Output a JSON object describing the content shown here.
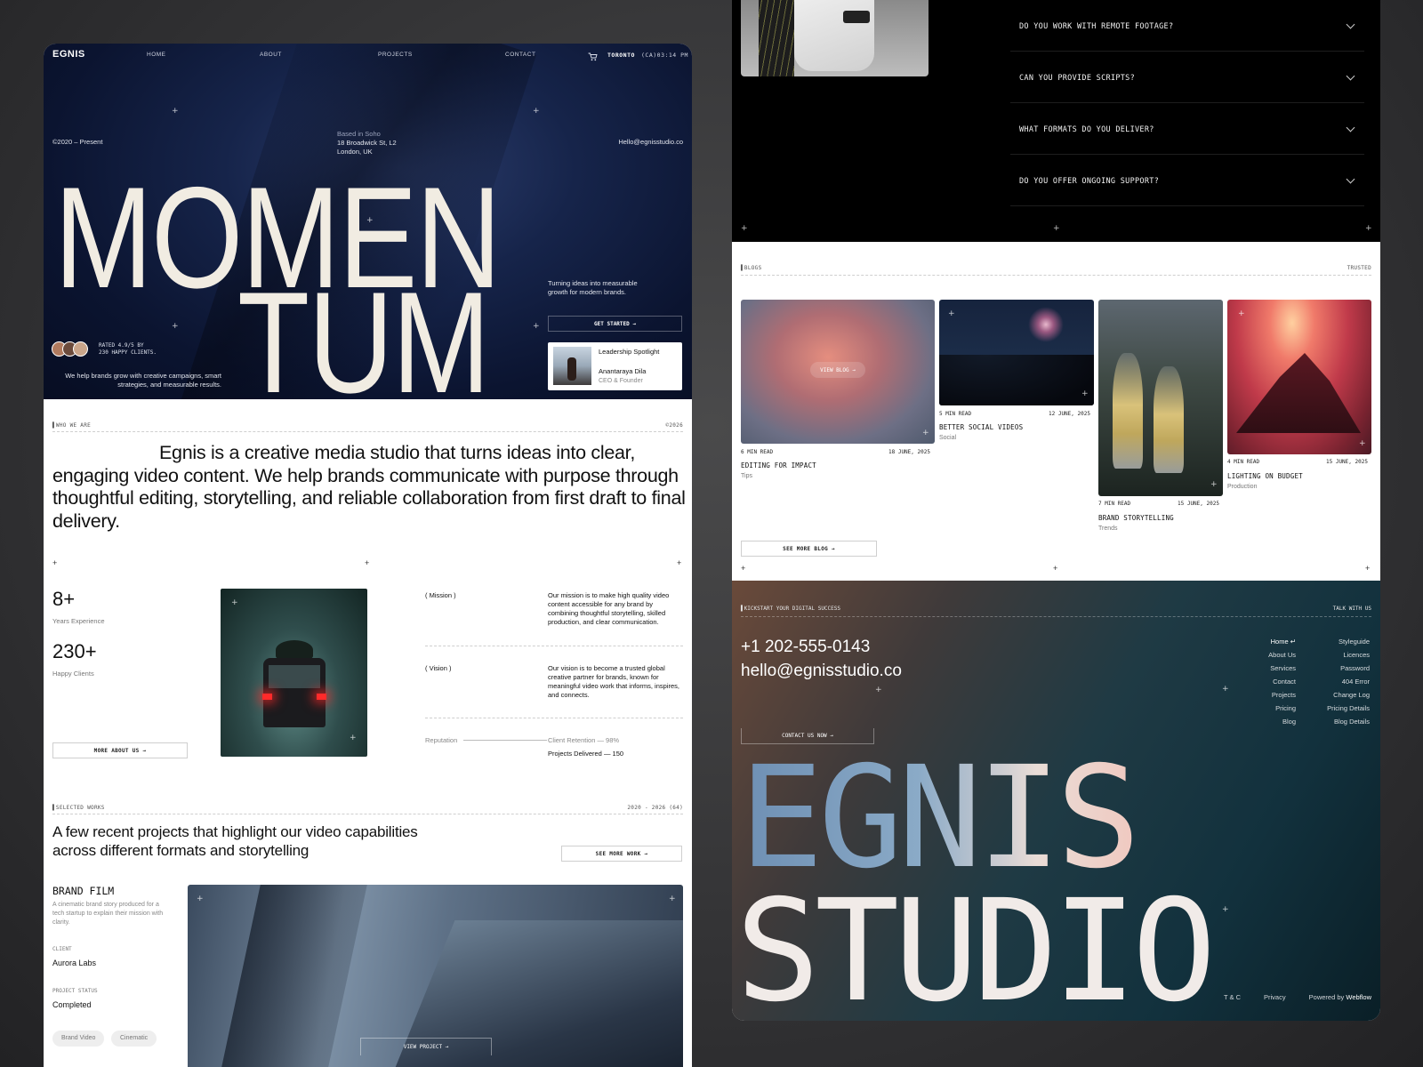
{
  "nav": {
    "logo": "EGNIS",
    "items": [
      "HOME",
      "ABOUT",
      "PROJECTS",
      "CONTACT"
    ],
    "city": "TORONTO",
    "clock": "(CA)03:14 PM"
  },
  "hero": {
    "since": "©2020 – Present",
    "address": [
      "Based in Soho",
      "18 Broadwick St, L2",
      "London, UK"
    ],
    "email": "Hello@egnisstudio.co",
    "title_line1": "MOMEN",
    "title_line2": "TUM",
    "tagline": "Turning ideas into measurable growth for modern brands.",
    "cta": "GET STARTED →",
    "rating_line1": "RATED 4.9/5 BY",
    "rating_line2": "230 HAPPY CLIENTS.",
    "sub": "We help brands grow with creative campaigns, smart strategies, and measurable results.",
    "spotlight": {
      "label": "Leadership Spotlight",
      "name": "Anantaraya Dila",
      "role": "CEO & Founder"
    }
  },
  "about": {
    "section": "WHO WE ARE",
    "year": "©2026",
    "statement": "Egnis is a creative media studio that turns ideas into clear, engaging video content. We help brands communicate with purpose through thoughtful editing, storytelling, and reliable collaboration from first draft to final delivery.",
    "stats": [
      {
        "value": "8+",
        "label": "Years Experience"
      },
      {
        "value": "230+",
        "label": "Happy Clients"
      }
    ],
    "more_btn": "MORE ABOUT US →",
    "mission_label": "( Mission )",
    "mission": "Our mission is to make high quality video content accessible for any brand by combining thoughtful storytelling, skilled production, and clear communication.",
    "vision_label": "( Vision )",
    "vision": "Our vision is to become a trusted global creative partner for brands, known for meaningful video work that informs, inspires, and connects.",
    "reputation_label": "Reputation",
    "retention": "Client Retention — 98%",
    "delivered": "Projects Delivered — 150"
  },
  "works": {
    "section": "SELECTED WORKS",
    "range": "2020 - 2026 (64)",
    "heading": "A few recent projects that highlight our video capabilities across different formats and storytelling",
    "see_more": "SEE MORE WORK →",
    "project": {
      "title": "BRAND FILM",
      "desc": "A cinematic brand story produced for a tech startup to explain their mission with clarity.",
      "client_label": "CLIENT",
      "client": "Aurora Labs",
      "status_label": "PROJECT STATUS",
      "status": "Completed",
      "tags": [
        "Brand Video",
        "Cinematic"
      ],
      "view_btn": "VIEW PROJECT →"
    }
  },
  "faq": {
    "questions": [
      "DO YOU WORK WITH REMOTE FOOTAGE?",
      "CAN YOU PROVIDE SCRIPTS?",
      "WHAT FORMATS DO YOU DELIVER?",
      "DO YOU OFFER ONGOING SUPPORT?"
    ]
  },
  "blogs": {
    "section": "BLOGS",
    "right": "TRUSTED",
    "view_blog": "VIEW BLOG →",
    "see_more": "SEE MORE BLOG →",
    "posts": [
      {
        "read": "6 MIN READ",
        "date": "18 JUNE, 2025",
        "title": "EDITING FOR IMPACT",
        "cat": "Tips"
      },
      {
        "read": "5 MIN READ",
        "date": "12 JUNE, 2025",
        "title": "BETTER SOCIAL VIDEOS",
        "cat": "Social"
      },
      {
        "read": "7 MIN READ",
        "date": "15 JUNE, 2025",
        "title": "BRAND STORYTELLING",
        "cat": "Trends"
      },
      {
        "read": "4 MIN READ",
        "date": "15 JUNE, 2025",
        "title": "LIGHTING ON BUDGET",
        "cat": "Production"
      }
    ]
  },
  "footer": {
    "section": "KICKSTART YOUR DIGITAL SUCCESS",
    "right": "TALK WITH US",
    "phone": "+1 202-555-0143",
    "email": "hello@egnisstudio.co",
    "contact_btn": "CONTACT US NOW →",
    "links_col1": [
      "Home ↵",
      "About Us",
      "Services",
      "Contact",
      "Projects",
      "Pricing",
      "Blog"
    ],
    "links_col2": [
      "Styleguide",
      "Licences",
      "Password",
      "404 Error",
      "Change Log",
      "Pricing Details",
      "Blog Details"
    ],
    "big_line1": "EGNIS",
    "big_line2": "STUDIO",
    "tc": "T & C",
    "privacy": "Privacy",
    "powered_by": "Powered by",
    "powered_brand": "Webflow"
  }
}
